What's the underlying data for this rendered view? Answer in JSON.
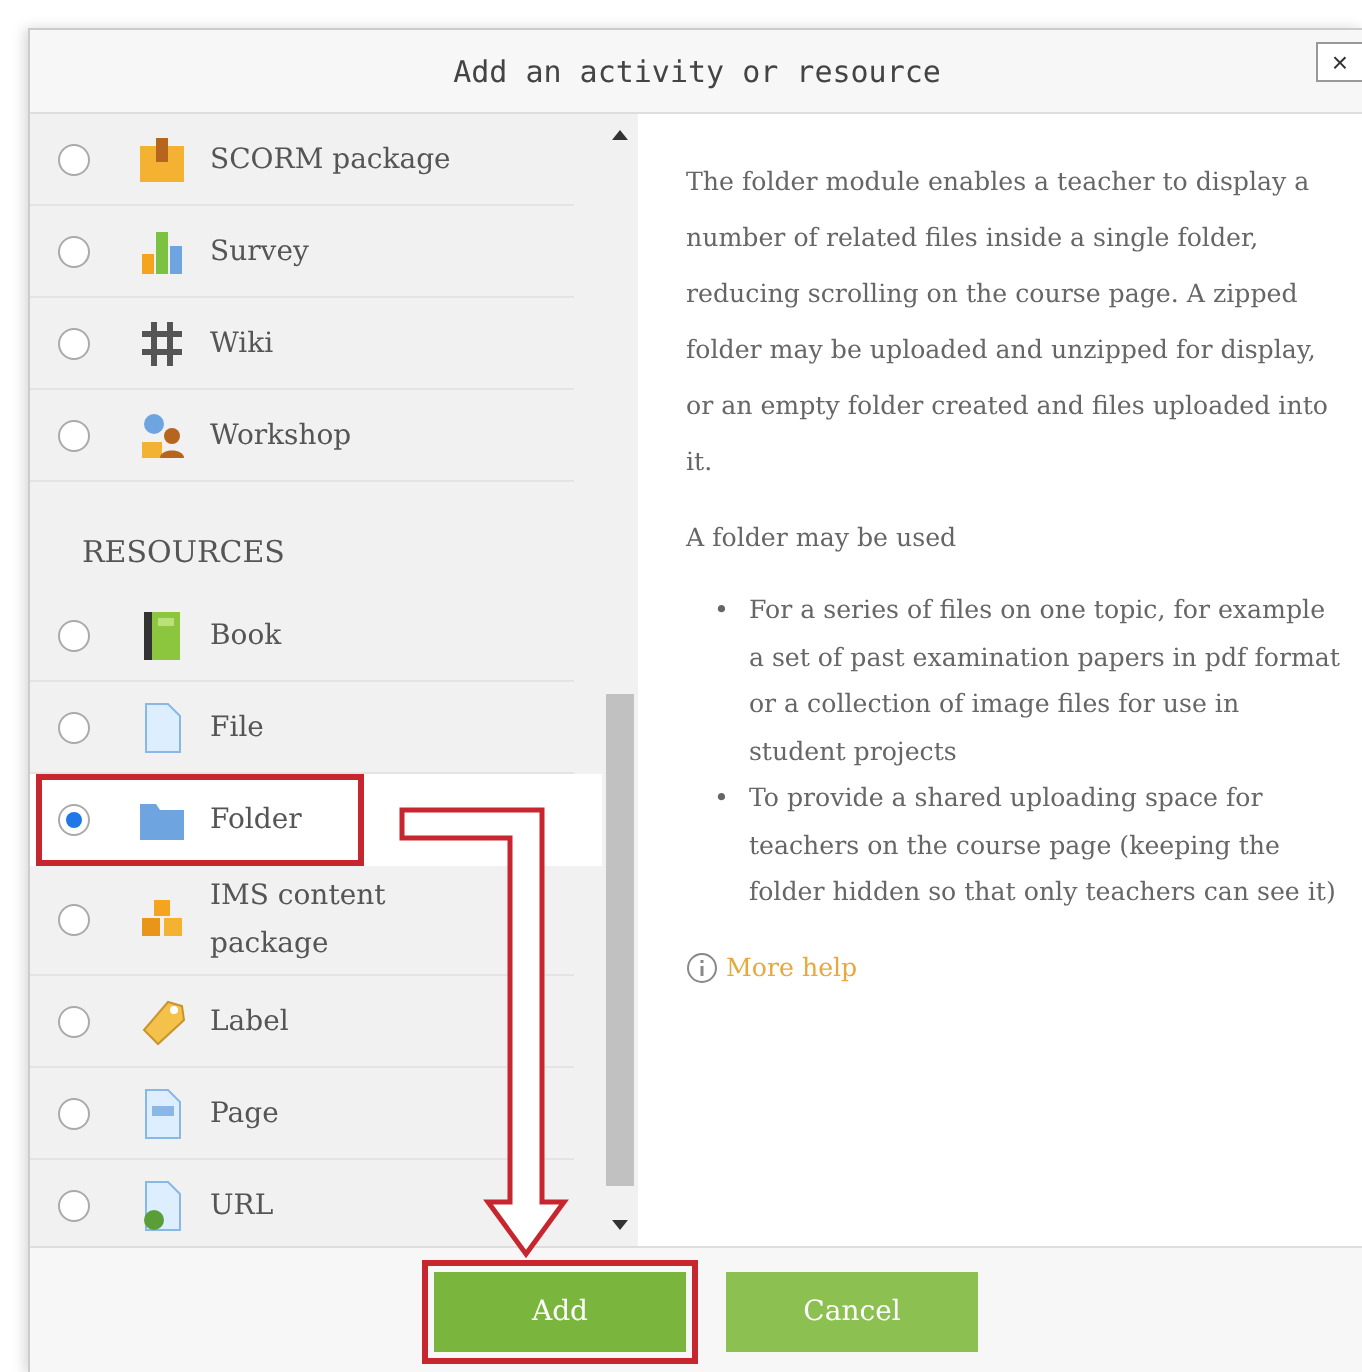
{
  "dialog": {
    "title": "Add an activity or resource",
    "close": "×"
  },
  "options": [
    {
      "kind": "option",
      "label": "SCORM package",
      "selected": false,
      "highlighted": false
    },
    {
      "kind": "option",
      "label": "Survey",
      "selected": false,
      "highlighted": false
    },
    {
      "kind": "option",
      "label": "Wiki",
      "selected": false,
      "highlighted": false
    },
    {
      "kind": "option",
      "label": "Workshop",
      "selected": false,
      "highlighted": false
    },
    {
      "kind": "heading",
      "label": "RESOURCES"
    },
    {
      "kind": "option",
      "label": "Book",
      "selected": false,
      "highlighted": false
    },
    {
      "kind": "option",
      "label": "File",
      "selected": false,
      "highlighted": false
    },
    {
      "kind": "option",
      "label": "Folder",
      "selected": true,
      "highlighted": true
    },
    {
      "kind": "option",
      "label": "IMS content package",
      "selected": false,
      "highlighted": false
    },
    {
      "kind": "option",
      "label": "Label",
      "selected": false,
      "highlighted": false
    },
    {
      "kind": "option",
      "label": "Page",
      "selected": false,
      "highlighted": false
    },
    {
      "kind": "option",
      "label": "URL",
      "selected": false,
      "highlighted": false
    }
  ],
  "description": {
    "paragraphs": [
      "The folder module enables a teacher to display a number of related files inside a single folder, reducing scrolling on the course page. A zipped folder may be uploaded and unzipped for display, or an empty folder created and files uploaded into it.",
      "A folder may be used"
    ],
    "bullets": [
      {
        "marker": "•",
        "text": "For a series of files on one topic, for example a set of past examination papers in pdf format or a collection of image files for use in student projects"
      },
      {
        "marker": "•",
        "text": "To provide a shared uploading space for teachers on the course page (keeping the folder hidden so that only teachers can see it)"
      }
    ],
    "help_link": "More help"
  },
  "buttons": [
    {
      "label": "Add",
      "kind": "primary",
      "highlighted": true
    },
    {
      "label": "Cancel",
      "kind": "secondary",
      "highlighted": false
    }
  ]
}
